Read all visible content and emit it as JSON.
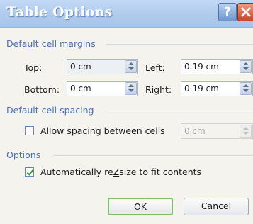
{
  "window": {
    "title": "Table Options",
    "help_glyph": "?",
    "icons": [
      "help-icon",
      "close-icon"
    ]
  },
  "margins": {
    "heading": "Default cell margins",
    "top": {
      "label_ul": "T",
      "label_rest": "op:",
      "value": "0 cm"
    },
    "bottom": {
      "label_ul": "B",
      "label_rest": "ottom:",
      "value": "0 cm"
    },
    "left": {
      "label_ul": "L",
      "label_rest": "eft:",
      "value": "0.19 cm"
    },
    "right": {
      "label_ul": "R",
      "label_rest": "ight:",
      "value": "0.19 cm"
    }
  },
  "spacing": {
    "heading": "Default cell spacing",
    "allow_label_ul": "A",
    "allow_label_rest": "llow spacing between cells",
    "allow_checked": false,
    "value": "0 cm"
  },
  "options": {
    "heading": "Options",
    "resize_label_ul": "Z",
    "resize_label_pre": "Automatically re",
    "resize_label_rest": "size to fit contents",
    "resize_checked": true
  },
  "buttons": {
    "ok": "OK",
    "cancel": "Cancel"
  },
  "colors": {
    "section_heading": "#4a72b0",
    "default_button_border": "#7fbf6b",
    "title_bar": "#b2cdee"
  }
}
